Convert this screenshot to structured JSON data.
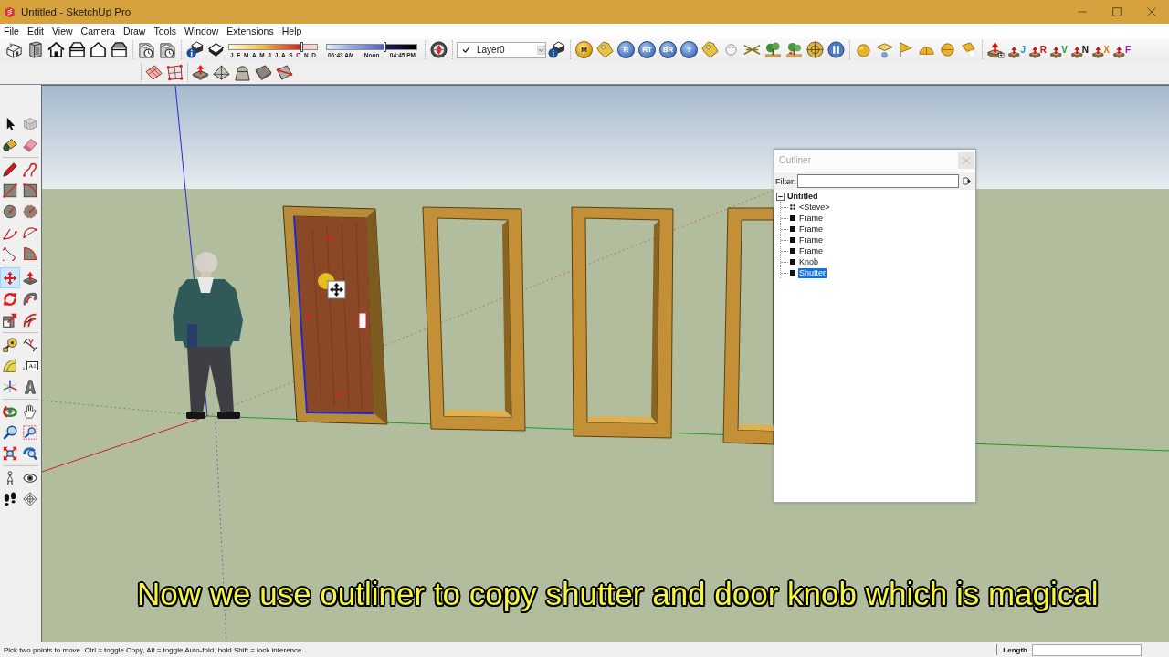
{
  "window": {
    "title": "Untitled - SketchUp Pro"
  },
  "menu": [
    "File",
    "Edit",
    "View",
    "Camera",
    "Draw",
    "Tools",
    "Window",
    "Extensions",
    "Help"
  ],
  "toolbar": {
    "shadow_date": {
      "months": [
        "J",
        "F",
        "M",
        "A",
        "M",
        "J",
        "J",
        "A",
        "S",
        "O",
        "N",
        "D"
      ],
      "level": 0.82
    },
    "shadow_time": {
      "start": "06:43 AM",
      "middle": "Noon",
      "end": "04:45 PM",
      "level": 0.64
    },
    "layer": {
      "name": "Layer0",
      "current": true
    },
    "plugin_buttons": [
      {
        "label": "M",
        "kind": "coin"
      },
      {
        "label": "R",
        "kind": "disc"
      },
      {
        "label": "RT",
        "kind": "disc"
      },
      {
        "label": "BR",
        "kind": "disc"
      },
      {
        "label": "?",
        "kind": "disc"
      }
    ],
    "push_buttons": [
      {
        "label": "J",
        "color": "#1f8fd0"
      },
      {
        "label": "R",
        "color": "#d01818"
      },
      {
        "label": "V",
        "color": "#1a9a3a"
      },
      {
        "label": "N",
        "color": "#111111"
      },
      {
        "label": "X",
        "color": "#e07a10"
      },
      {
        "label": "F",
        "color": "#9a22a8"
      }
    ]
  },
  "tool_groups": [
    {
      "tools": [
        {
          "selected": false
        },
        {
          "selected": false
        },
        {
          "selected": false
        },
        {
          "selected": false
        }
      ]
    },
    {
      "tools": [
        {
          "selected": false
        },
        {
          "selected": false
        },
        {
          "selected": false
        },
        {
          "selected": false
        },
        {
          "selected": false
        },
        {
          "selected": false
        },
        {
          "selected": false
        },
        {
          "selected": false
        },
        {
          "selected": false
        },
        {
          "selected": false
        }
      ]
    },
    {
      "tools": [
        {
          "selected": true
        },
        {
          "selected": false
        },
        {
          "selected": false
        },
        {
          "selected": false
        },
        {
          "selected": false
        },
        {
          "selected": false
        }
      ]
    },
    {
      "tools": [
        {
          "selected": false
        },
        {
          "selected": false
        },
        {
          "selected": false
        },
        {
          "selected": false,
          "label": "A1"
        },
        {
          "selected": false
        },
        {
          "selected": false
        }
      ]
    },
    {
      "tools": [
        {
          "selected": false
        },
        {
          "selected": false
        },
        {
          "selected": false
        },
        {
          "selected": false
        },
        {
          "selected": false
        },
        {
          "selected": false
        }
      ]
    },
    {
      "tools": [
        {
          "selected": false
        },
        {
          "selected": false
        },
        {
          "selected": false
        },
        {
          "selected": false
        }
      ]
    }
  ],
  "outliner": {
    "title": "Outliner",
    "filter_label": "Filter:",
    "tree": {
      "label": "Untitled",
      "expanded": true,
      "selected": false,
      "children": [
        {
          "label": "<Steve>",
          "kind": "component",
          "selected": false
        },
        {
          "label": "Frame",
          "kind": "group",
          "selected": false
        },
        {
          "label": "Frame",
          "kind": "group",
          "selected": false
        },
        {
          "label": "Frame",
          "kind": "group",
          "selected": false
        },
        {
          "label": "Frame",
          "kind": "group",
          "selected": false
        },
        {
          "label": "Knob",
          "kind": "group",
          "selected": false
        },
        {
          "label": "Shutter",
          "kind": "group",
          "selected": true
        }
      ]
    }
  },
  "caption": "Now we use outliner to copy shutter and door knob which is magical",
  "status_bar": {
    "hint": "Pick two points to move. Ctrl = toggle Copy, Alt = toggle Auto-fold, hold Shift = lock inference.",
    "measurement_label": "Length"
  }
}
